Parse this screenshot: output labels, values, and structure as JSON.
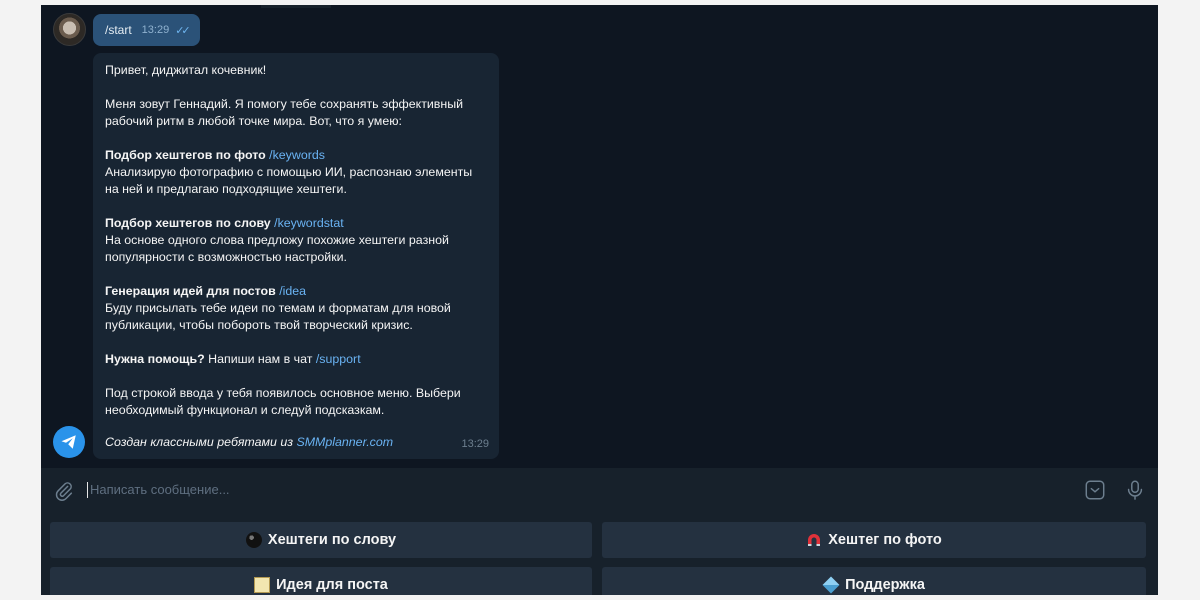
{
  "chat": {
    "outgoing": {
      "text": "/start",
      "time": "13:29"
    },
    "incoming": {
      "greeting": "Привет, диджитал кочевник!",
      "intro": "Меня зовут Геннадий. Я помогу тебе сохранять эффективный рабочий ритм в любой точке мира. Вот, что я умею:",
      "features": [
        {
          "title": "Подбор хештегов по фото",
          "command": "/keywords",
          "description": "Анализирую фотографию с помощью ИИ, распознаю элементы на ней и предлагаю подходящие хештеги."
        },
        {
          "title": "Подбор хештегов по слову",
          "command": "/keywordstat",
          "description": "На основе одного слова предложу похожие хештеги разной популярности с возможностью настройки."
        },
        {
          "title": "Генерация идей для постов",
          "command": "/idea",
          "description": "Буду присылать тебе идеи по темам и форматам для новой публикации, чтобы побороть твой творческий кризис."
        }
      ],
      "help_bold": "Нужна помощь?",
      "help_text": "Напиши нам в чат",
      "help_command": "/support",
      "menu_note": "Под строкой ввода у тебя появилось основное меню. Выбери необходимый функционал и следуй подсказкам.",
      "footer_text": "Создан классными ребятами из",
      "footer_link": "SMMplanner.com",
      "time": "13:29"
    }
  },
  "input": {
    "placeholder": "Написать сообщение..."
  },
  "keyboard": {
    "buttons": [
      {
        "label": "Хештеги по слову",
        "icon": "billiard-ball-icon"
      },
      {
        "label": "Хештег по фото",
        "icon": "magnet-icon"
      },
      {
        "label": "Идея для поста",
        "icon": "memo-icon"
      },
      {
        "label": "Поддержка",
        "icon": "package-icon"
      }
    ]
  },
  "colors": {
    "background": "#0e1621",
    "incoming_bubble": "#182533",
    "outgoing_bubble": "#2b5278",
    "link": "#6ab3f3",
    "button": "#243140"
  }
}
